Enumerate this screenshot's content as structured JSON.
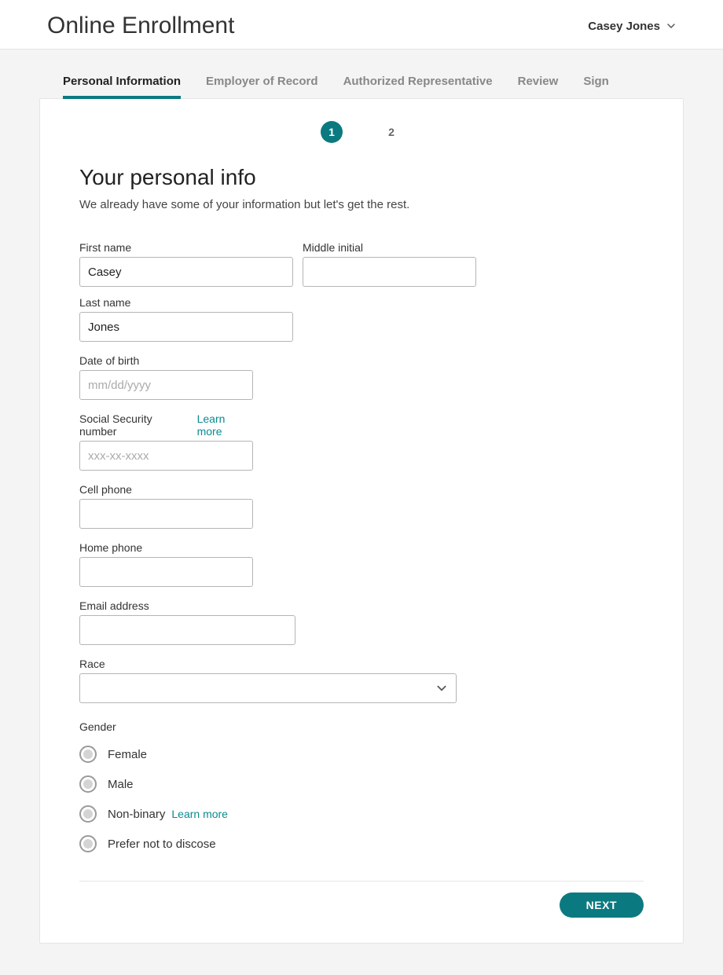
{
  "header": {
    "title": "Online Enrollment",
    "user_name": "Casey Jones"
  },
  "tabs": [
    {
      "label": "Personal Information",
      "active": true
    },
    {
      "label": "Employer of Record",
      "active": false
    },
    {
      "label": "Authorized Representative",
      "active": false
    },
    {
      "label": "Review",
      "active": false
    },
    {
      "label": "Sign",
      "active": false
    }
  ],
  "stepper": {
    "step1": "1",
    "step2": "2"
  },
  "section": {
    "title": "Your personal info",
    "subtitle": "We already have some of your information but let's get the rest."
  },
  "fields": {
    "first_name": {
      "label": "First name",
      "value": "Casey"
    },
    "middle_initial": {
      "label": "Middle initial",
      "value": ""
    },
    "last_name": {
      "label": "Last name",
      "value": "Jones"
    },
    "dob": {
      "label": "Date of birth",
      "placeholder": "mm/dd/yyyy",
      "value": ""
    },
    "ssn": {
      "label": "Social Security number",
      "learn_more": "Learn more",
      "placeholder": "xxx-xx-xxxx",
      "value": ""
    },
    "cell_phone": {
      "label": "Cell phone",
      "value": ""
    },
    "home_phone": {
      "label": "Home phone",
      "value": ""
    },
    "email": {
      "label": "Email address",
      "value": ""
    },
    "race": {
      "label": "Race",
      "value": ""
    },
    "gender": {
      "label": "Gender",
      "options": [
        {
          "label": "Female"
        },
        {
          "label": "Male"
        },
        {
          "label": "Non-binary",
          "learn_more": "Learn more"
        },
        {
          "label": "Prefer not to discose"
        }
      ]
    }
  },
  "buttons": {
    "next": "NEXT"
  },
  "colors": {
    "accent": "#0b7a80"
  }
}
